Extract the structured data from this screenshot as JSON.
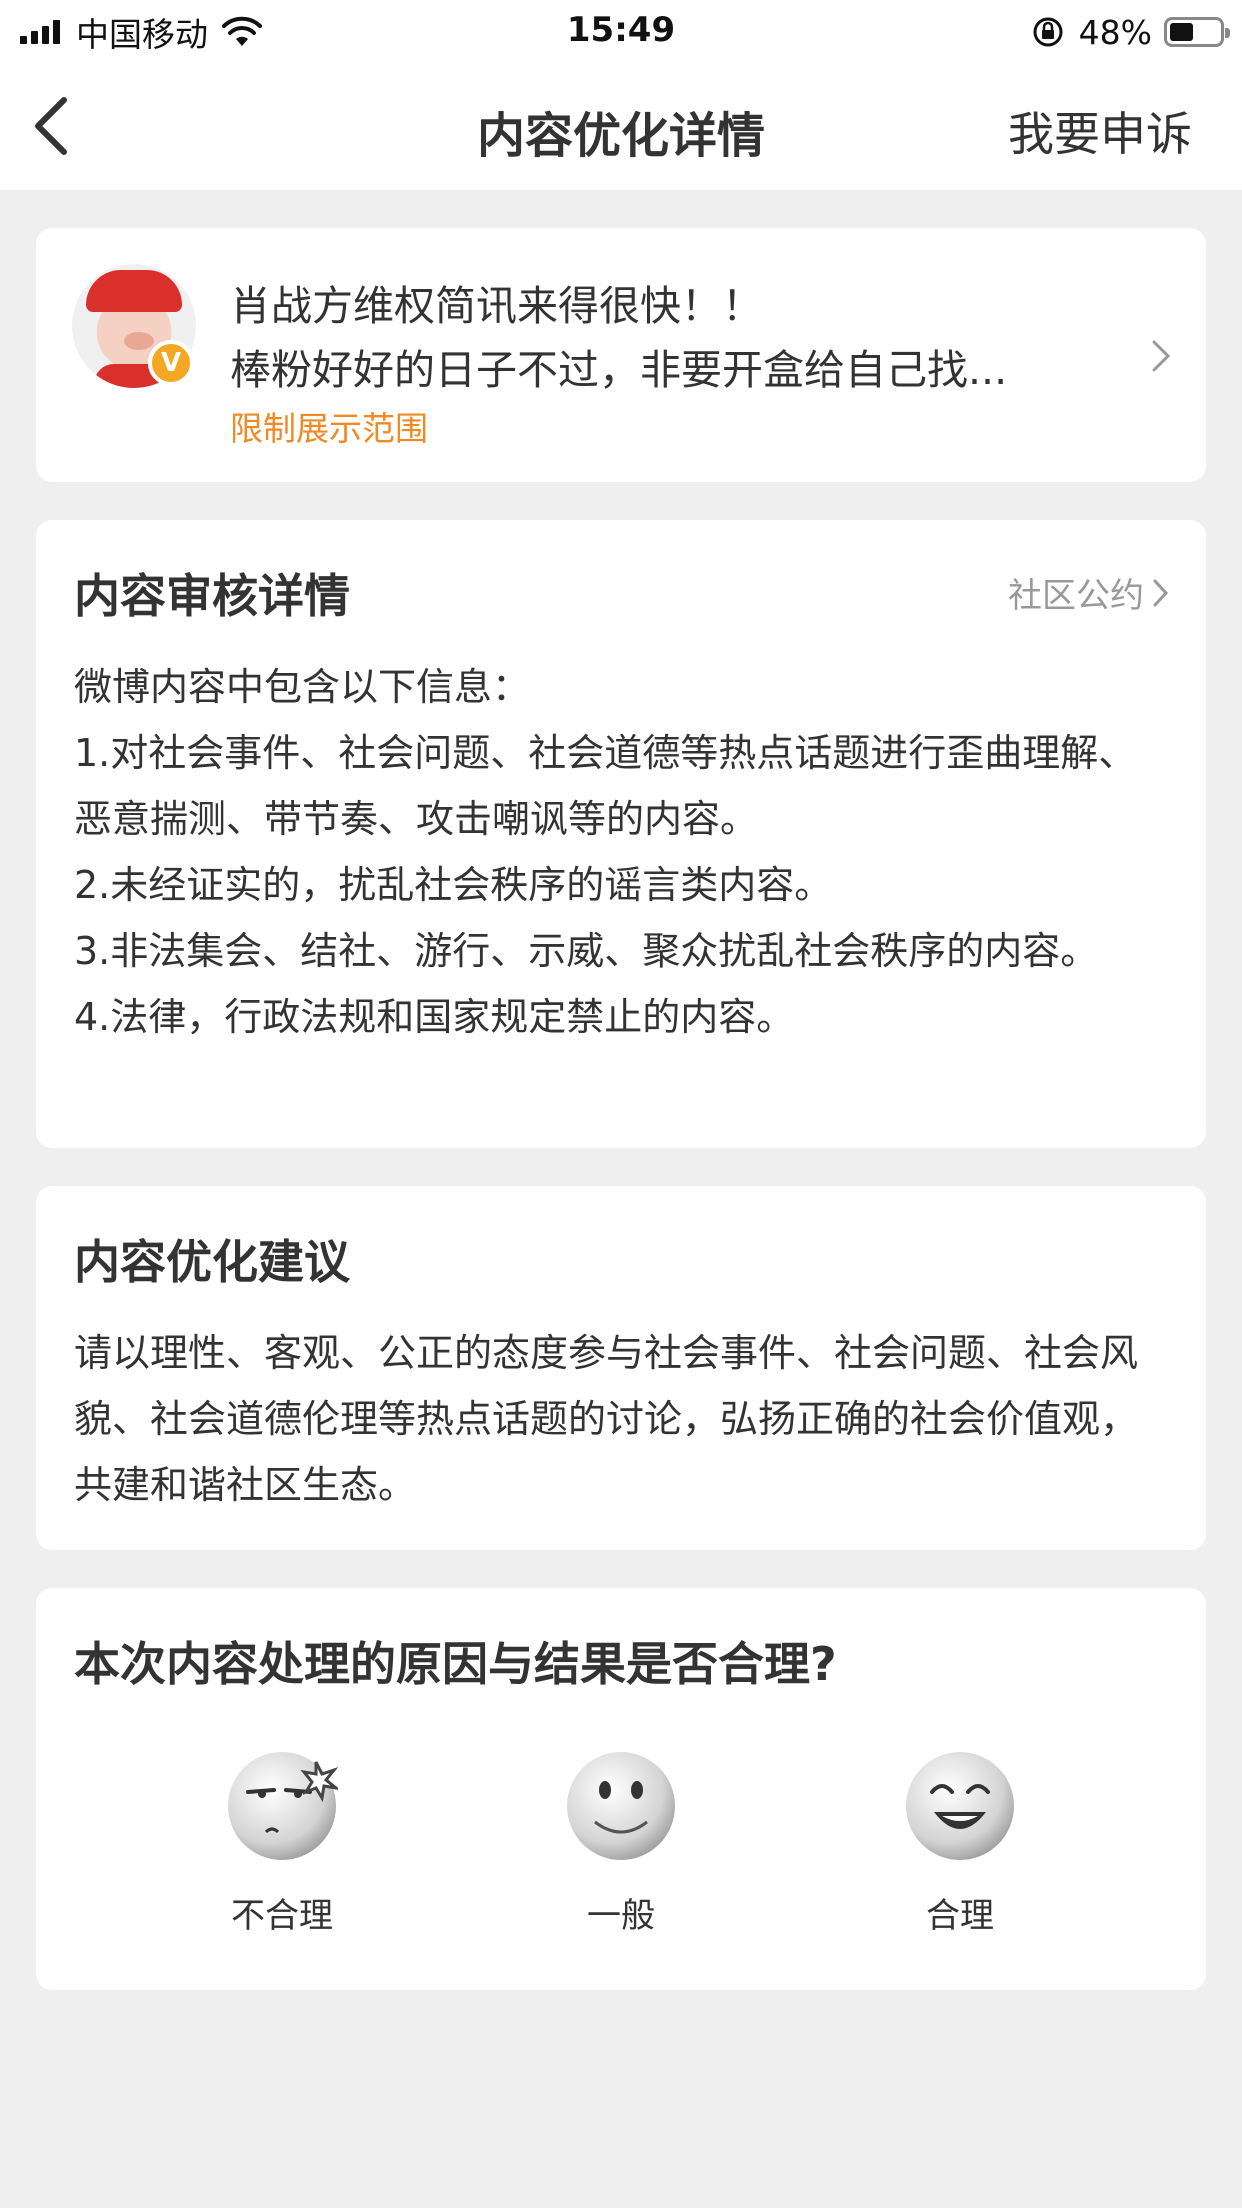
{
  "status_bar": {
    "carrier": "中国移动",
    "time": "15:49",
    "battery": "48%",
    "battery_level": 0.48
  },
  "nav": {
    "title": "内容优化详情",
    "appeal": "我要申诉"
  },
  "post": {
    "line1": "肖战方维权简讯来得很快！！",
    "line2": "棒粉好好的日子不过，非要开盒给自己找...",
    "status": "限制展示范围",
    "badge": "V"
  },
  "review": {
    "title": "内容审核详情",
    "link": "社区公约",
    "intro": "微博内容中包含以下信息：",
    "items": [
      "1.对社会事件、社会问题、社会道德等热点话题进行歪曲理解、恶意揣测、带节奏、攻击嘲讽等的内容。",
      "2.未经证实的，扰乱社会秩序的谣言类内容。",
      "3.非法集会、结社、游行、示威、聚众扰乱社会秩序的内容。",
      "4.法律，行政法规和国家规定禁止的内容。"
    ]
  },
  "suggestion": {
    "title": "内容优化建议",
    "body": "请以理性、客观、公正的态度参与社会事件、社会问题、社会风貌、社会道德伦理等热点话题的讨论，弘扬正确的社会价值观，共建和谐社区生态。"
  },
  "feedback": {
    "question": "本次内容处理的原因与结果是否合理?",
    "options": [
      {
        "label": "不合理",
        "icon": "annoyed-face-icon"
      },
      {
        "label": "一般",
        "icon": "neutral-face-icon"
      },
      {
        "label": "合理",
        "icon": "happy-face-icon"
      }
    ]
  }
}
